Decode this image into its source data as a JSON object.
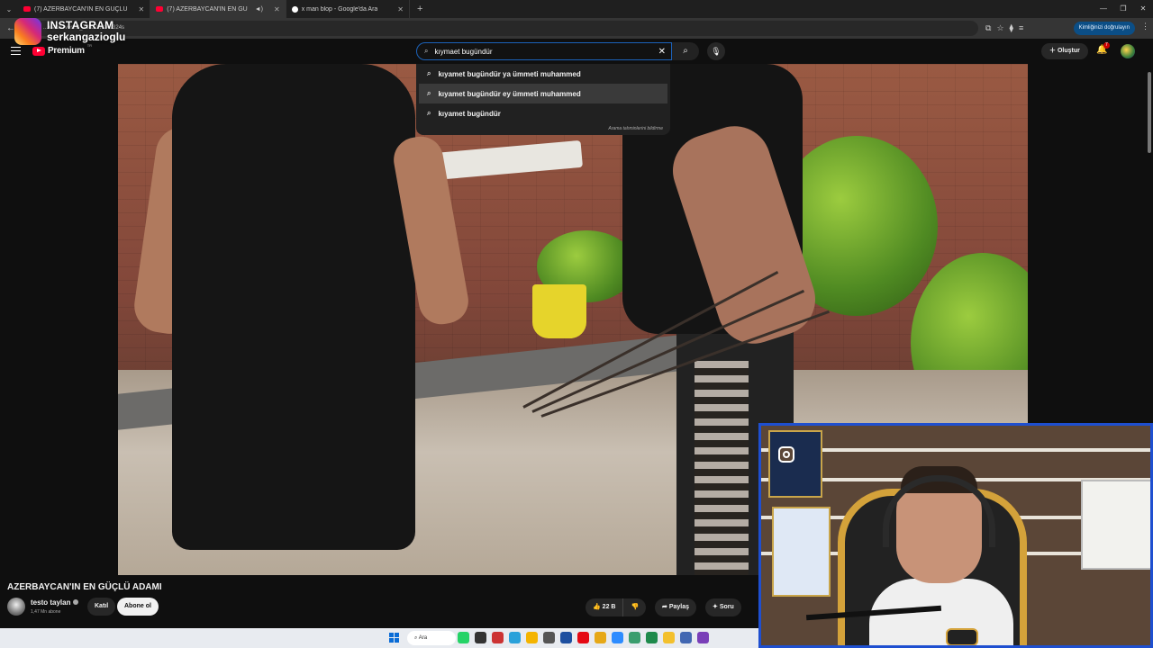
{
  "browser": {
    "tabs": [
      {
        "title": "(7) AZERBAYCAN'IN EN GÜÇLÜ",
        "active": false
      },
      {
        "title": "(7) AZERBAYCAN'IN EN GÜ",
        "active": true
      },
      {
        "title": "x man blop - Google'da Ara",
        "active": false
      }
    ],
    "url": "...watch?v=sn8_T8hz7w&t=1324s",
    "verify_label": "Kimliğinizi doğrulayın"
  },
  "overlay": {
    "platform": "INSTAGRAM",
    "handle": "serkangazioglu"
  },
  "youtube": {
    "logo_text": "Premium",
    "region": "TR",
    "search": {
      "query": "kıymaet bugündür",
      "suggestions": [
        "kıyamet bugündür ya ümmeti muhammed",
        "kıyamet bugündür ey ümmeti muhammed",
        "kıyamet bugündür"
      ],
      "report_label": "Arama tahminlerini bildirme"
    },
    "create_label": "Oluştur",
    "notification_count": "7"
  },
  "video": {
    "title": "AZERBAYCAN'IN EN GÜÇLÜ ADAMI",
    "channel": "testo taylan",
    "subscribers": "1,47 Mn abone",
    "join_label": "Katıl",
    "subscribe_label": "Abone ol",
    "likes": "22 B",
    "share_label": "Paylaş",
    "ask_label": "Soru"
  },
  "taskbar": {
    "search_label": "Ara"
  },
  "icons": {
    "search": "search-icon",
    "mic": "mic-icon",
    "bell": "bell-icon",
    "like": "thumbs-up-icon",
    "dislike": "thumbs-down-icon",
    "share": "share-icon",
    "ask": "sparkle-icon"
  }
}
